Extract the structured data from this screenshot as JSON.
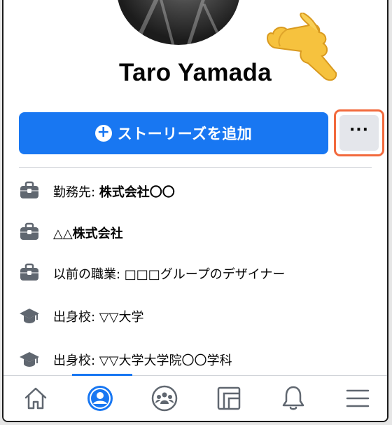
{
  "profile": {
    "name": "Taro Yamada"
  },
  "actions": {
    "add_story_label": "ストーリーズを追加",
    "more_label": "···"
  },
  "info": [
    {
      "icon": "briefcase-icon",
      "prefix": "勤務先: ",
      "value": "株式会社〇〇"
    },
    {
      "icon": "briefcase-icon",
      "prefix": "",
      "value": "△△株式会社"
    },
    {
      "icon": "briefcase-icon",
      "prefix": "以前の職業: □□□グループのデザイナー",
      "value": ""
    },
    {
      "icon": "graduation-cap-icon",
      "prefix": "出身校: ▽▽大学",
      "value": ""
    },
    {
      "icon": "graduation-cap-icon",
      "prefix": "出身校: ▽▽大学大学院〇〇学科",
      "value": ""
    }
  ],
  "tabs": [
    {
      "name": "home",
      "icon": "home-icon",
      "active": false
    },
    {
      "name": "profile",
      "icon": "profile-icon",
      "active": true
    },
    {
      "name": "groups",
      "icon": "groups-icon",
      "active": false
    },
    {
      "name": "feeds",
      "icon": "feeds-icon",
      "active": false
    },
    {
      "name": "notifications",
      "icon": "bell-icon",
      "active": false
    },
    {
      "name": "menu",
      "icon": "menu-icon",
      "active": false
    }
  ],
  "colors": {
    "primary": "#1877f2",
    "highlight": "#f26a3d",
    "secondary_button": "#e4e6eb",
    "icon_gray": "#606770"
  }
}
